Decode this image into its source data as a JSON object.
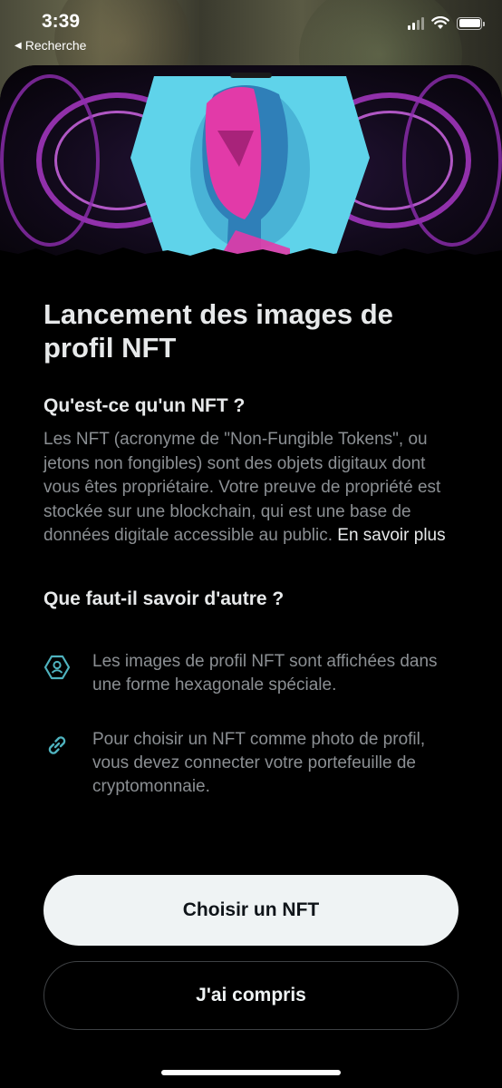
{
  "status_bar": {
    "time": "3:39",
    "back_label": "Recherche",
    "icons": [
      "cellular-signal-icon",
      "wifi-icon",
      "battery-icon"
    ]
  },
  "sheet": {
    "title": "Lancement des images de profil NFT",
    "section1": {
      "heading": "Qu'est-ce qu'un NFT ?",
      "body": "Les NFT (acronyme de \"Non-Fungible Tokens\", ou jetons non fongibles) sont des objets digitaux dont vous êtes propriétaire. Votre preuve de propriété est stockée sur une blockchain, qui est une base de données digitale accessible au public.",
      "link": "En savoir plus"
    },
    "section2": {
      "heading": "Que faut-il savoir d'autre ?",
      "features": [
        {
          "icon": "hexagon-profile-icon",
          "text": "Les images de profil NFT sont affichées dans une forme hexagonale spéciale."
        },
        {
          "icon": "link-icon",
          "text": "Pour choisir un NFT comme photo de profil, vous devez connecter votre portefeuille de cryptomonnaie."
        }
      ]
    },
    "buttons": {
      "primary": "Choisir un NFT",
      "secondary": "J'ai compris"
    }
  },
  "colors": {
    "background": "#000000",
    "title_text": "#e7e9ea",
    "body_text": "#8b8f93",
    "icon_accent": "#4fb3bf",
    "primary_button_bg": "#eff3f4",
    "secondary_button_border": "#3e4144"
  }
}
